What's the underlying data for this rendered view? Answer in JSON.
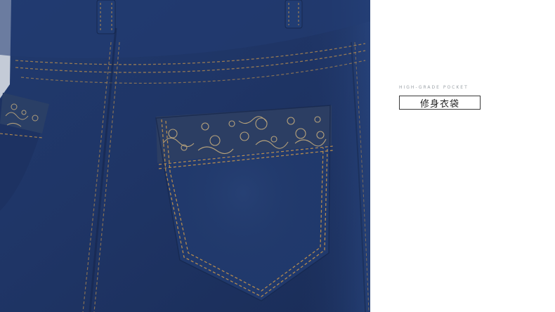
{
  "product_photo": {
    "subject": "jeans-back-pocket-closeup",
    "colors": {
      "denim": "#1f3566",
      "denim_highlight": "#2f4a80",
      "stitching": "#b28a50",
      "embroidery": "#c6ad7e",
      "background": "#ffffff"
    }
  },
  "caption": {
    "english": "HIGH-GRADE POCKET",
    "chinese": "修身衣袋"
  }
}
